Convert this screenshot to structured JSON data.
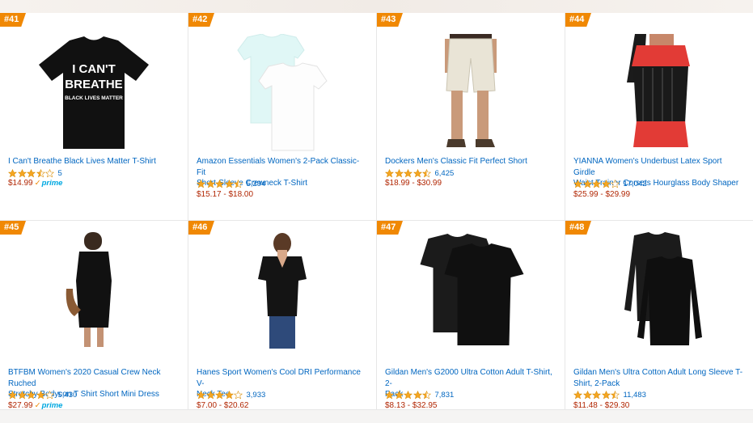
{
  "products": [
    {
      "rank": "#41",
      "title_lines": [
        "I Can't Breathe Black Lives Matter T-Shirt"
      ],
      "rating": 3.5,
      "reviews": "5",
      "price": "$14.99",
      "prime": true,
      "image": "black-tshirt-icant-breathe",
      "shirt_text": [
        "I CAN'T",
        "BREATHE",
        "BLACK LIVES MATTER"
      ]
    },
    {
      "rank": "#42",
      "title_lines": [
        "Amazon Essentials Women's 2-Pack Classic-Fit",
        "Short-Sleeve Crewneck T-Shirt"
      ],
      "rating": 4.5,
      "reviews": "5,294",
      "price": "$15.17 - $18.00",
      "prime": false,
      "image": "two-white-tshirts"
    },
    {
      "rank": "#43",
      "title_lines": [
        "Dockers Men's Classic Fit Perfect Short"
      ],
      "rating": 4.5,
      "reviews": "6,425",
      "price": "$18.99 - $30.99",
      "prime": false,
      "image": "khaki-shorts"
    },
    {
      "rank": "#44",
      "title_lines": [
        "YIANNA Women's Underbust Latex Sport Girdle",
        "Waist Trainer Corsets Hourglass Body Shaper"
      ],
      "rating": 4,
      "reviews": "17,042",
      "price": "$25.99 - $29.99",
      "prime": false,
      "image": "waist-trainer"
    },
    {
      "rank": "#45",
      "title_lines": [
        "BTFBM Women's 2020 Casual Crew Neck Ruched",
        "Stretchy Bodycon T Shirt Short Mini Dress"
      ],
      "rating": 4,
      "reviews": "5,430",
      "price": "$27.99",
      "prime": true,
      "image": "black-mini-dress"
    },
    {
      "rank": "#46",
      "title_lines": [
        "Hanes Sport Women's Cool DRI Performance V-",
        "Neck Tee"
      ],
      "rating": 4,
      "reviews": "3,933",
      "price": "$7.00 - $20.62",
      "prime": false,
      "image": "womens-black-vneck"
    },
    {
      "rank": "#47",
      "title_lines": [
        "Gildan Men's G2000 Ultra Cotton Adult T-Shirt, 2-",
        "Pack"
      ],
      "rating": 4.5,
      "reviews": "7,831",
      "price": "$8.13 - $32.95",
      "prime": false,
      "image": "black-tshirts-2pack"
    },
    {
      "rank": "#48",
      "title_lines": [
        "Gildan Men's Ultra Cotton Adult Long Sleeve T-",
        "Shirt, 2-Pack"
      ],
      "rating": 4.5,
      "reviews": "11,483",
      "price": "$11.48 - $29.30",
      "prime": false,
      "image": "black-longsleeve-2pack"
    }
  ],
  "prime_label": "prime",
  "prime_check": "✓",
  "colors": {
    "rank_badge": "#f08804",
    "link": "#0066c0",
    "price": "#b12704",
    "star": "#f5a623",
    "prime": "#00a8e1"
  }
}
